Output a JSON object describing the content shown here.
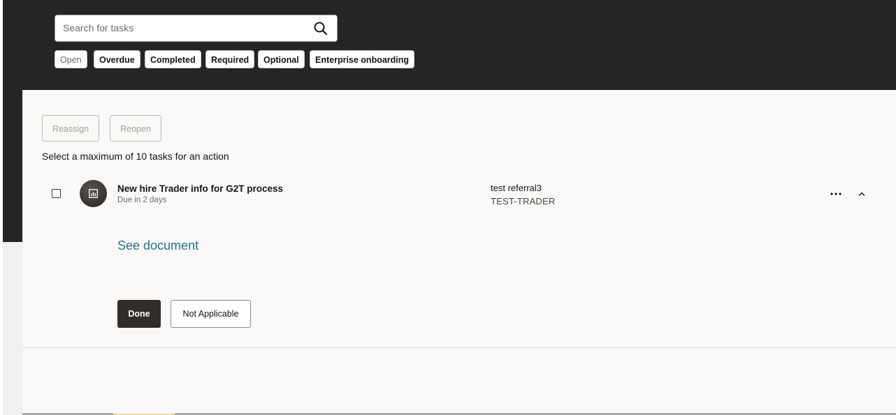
{
  "search": {
    "placeholder": "Search for tasks",
    "icon": "search-icon"
  },
  "filters": [
    {
      "label": "Open",
      "selected": true
    },
    {
      "label": "Overdue",
      "selected": false
    },
    {
      "label": "Completed",
      "selected": false
    },
    {
      "label": "Required",
      "selected": false
    },
    {
      "label": "Optional",
      "selected": false
    },
    {
      "label": "Enterprise onboarding",
      "selected": false
    }
  ],
  "actions": {
    "reassign": "Reassign",
    "reopen": "Reopen"
  },
  "hint": "Select a maximum of 10 tasks for an action",
  "task": {
    "title": "New hire Trader info for G2T process",
    "due": "Due in 2 days",
    "assignee_name": "test referral3",
    "assignee_role": "TEST-TRADER",
    "link": "See document",
    "done_label": "Done",
    "na_label": "Not Applicable",
    "icons": {
      "avatar": "chart-icon",
      "more": "more-icon",
      "collapse": "chevron-up-icon"
    }
  },
  "colors": {
    "header_bg": "#252525",
    "panel_bg": "#faf9f7",
    "link": "#227290",
    "primary_button": "#312d2a"
  }
}
